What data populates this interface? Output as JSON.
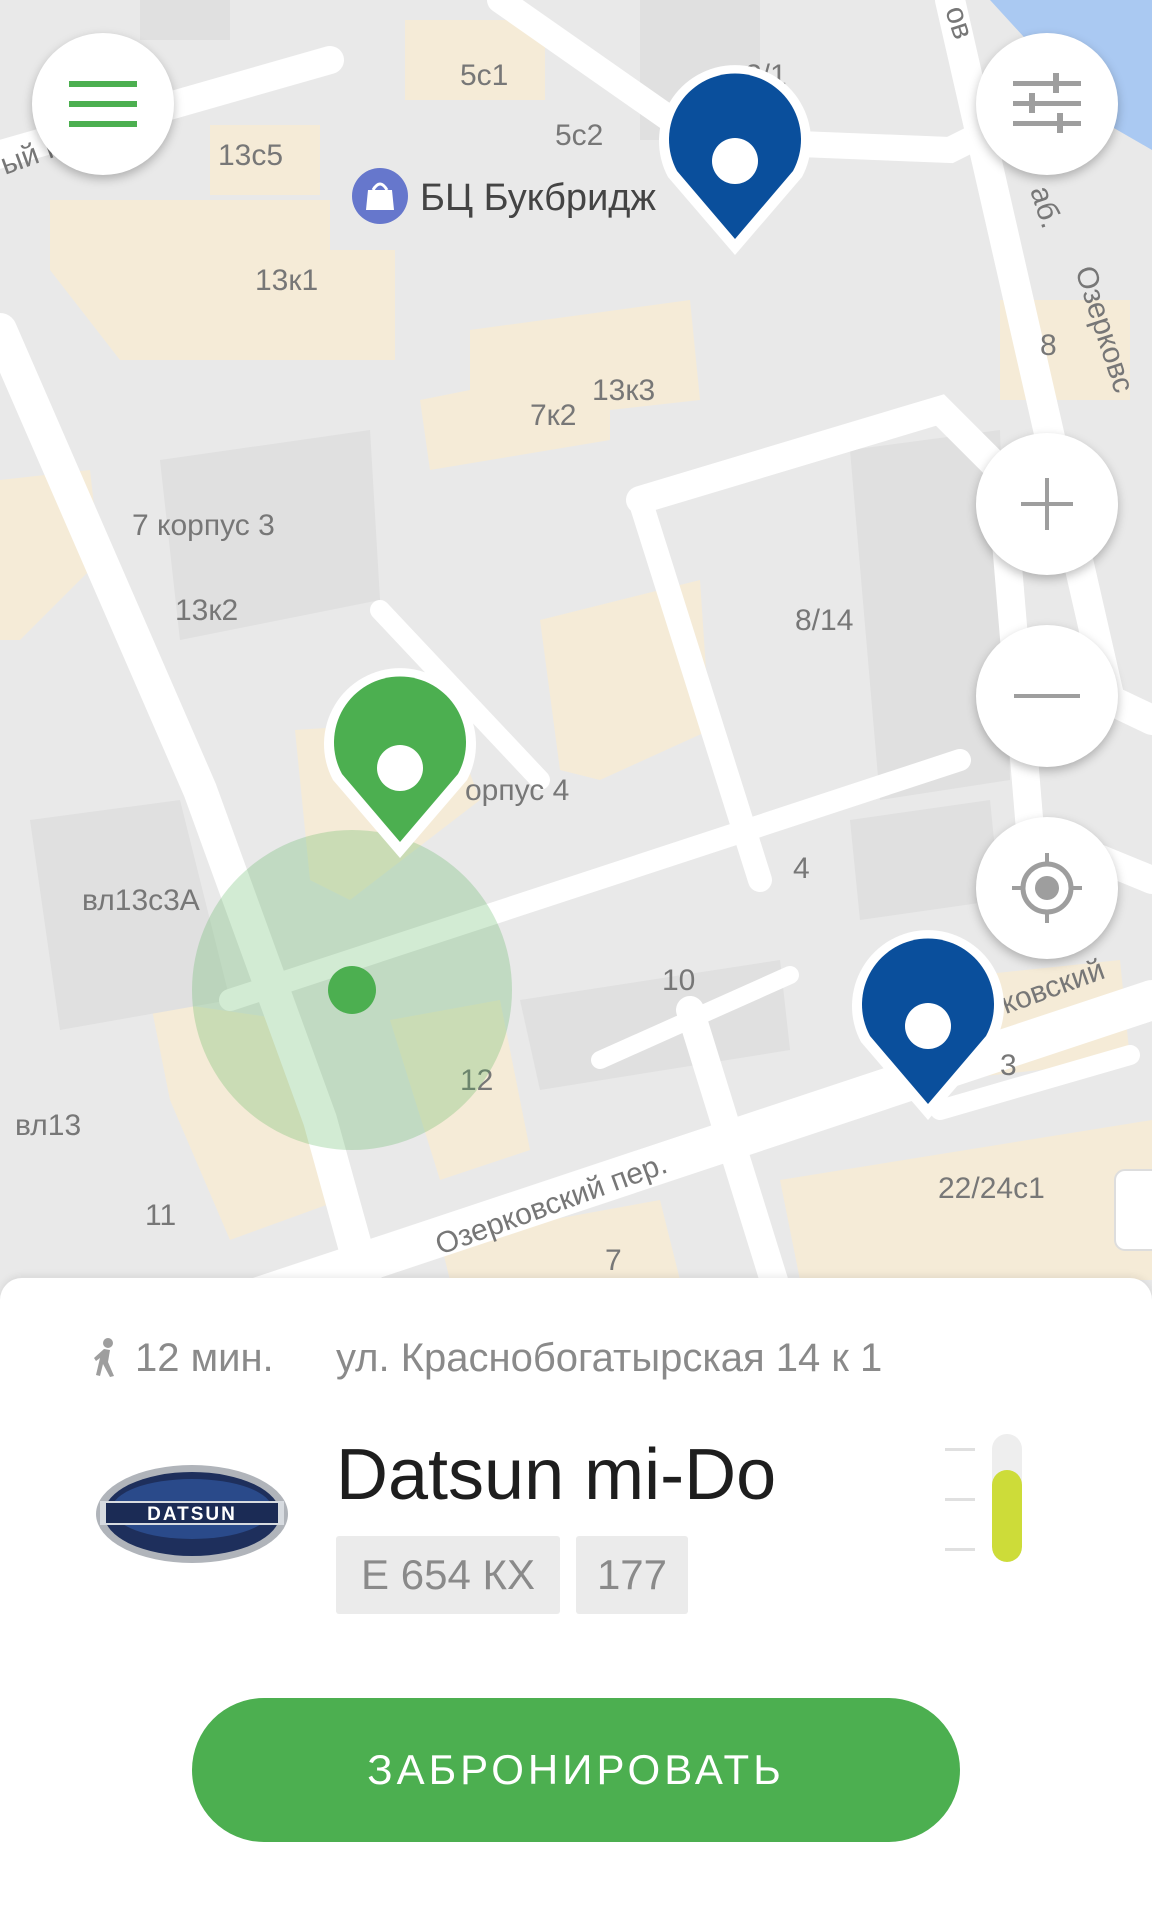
{
  "map": {
    "labels": {
      "street_top": "ый пер.",
      "b_5c1": "5с1",
      "b_2_1": "2/1",
      "b_13c5": "13с5",
      "b_5c2": "5с2",
      "poi": "БЦ Букбридж",
      "b_13k1": "13к1",
      "b_8": "8",
      "b_13k3": "13к3",
      "b_7k2": "7к2",
      "b_7k3": "7 корпус 3",
      "b_13k2": "13к2",
      "b_8_14": "8/14",
      "b_k4": "орпус 4",
      "b_4": "4",
      "b_vl13c3a": "вл13с3А",
      "b_10": "10",
      "b_12": "12",
      "b_3": "3",
      "b_vl13": "вл13",
      "b_11": "11",
      "b_22_24c1": "22/24с1",
      "b_7": "7",
      "street_ozerk": "Озерковский пер.",
      "street_ozerk_right": "рковский",
      "street_nab": "Озерковс",
      "street_nab2": "аб.",
      "street_vert_top": "ов"
    }
  },
  "controls": {
    "menu_icon": "hamburger-menu-icon",
    "filter_icon": "sliders-icon",
    "zoom_in_icon": "plus-icon",
    "zoom_out_icon": "minus-icon",
    "locate_icon": "crosshair-target-icon"
  },
  "car": {
    "walk_time": "12 мин.",
    "address": "ул. Краснобогатырская 14 к 1",
    "model": "Datsun mi-Do",
    "logo_text": "DATSUN",
    "plate_number": "Е 654 КХ",
    "plate_region": "177",
    "fuel_level": 0.72
  },
  "book_button": "ЗАБРОНИРОВАТЬ",
  "colors": {
    "accent": "#4caf50",
    "pin_blue": "#0a4f9c",
    "fuel": "#cddc39"
  }
}
